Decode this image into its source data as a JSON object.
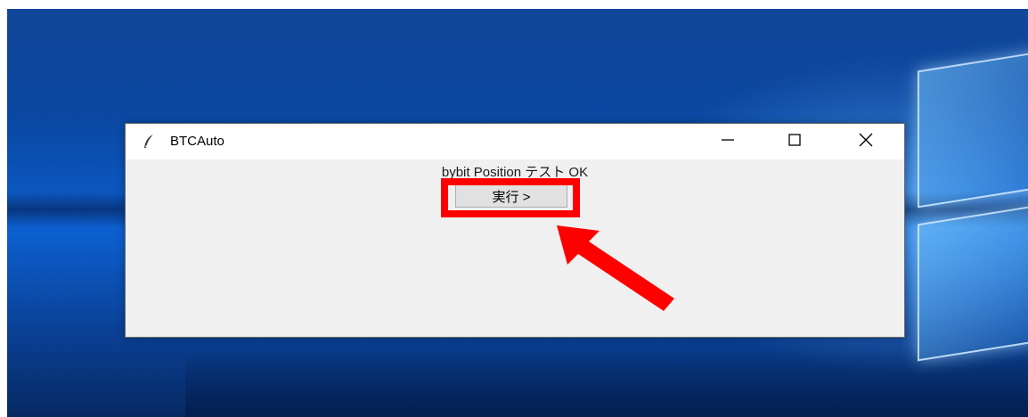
{
  "window": {
    "title": "BTCAuto",
    "icon": "feather-icon",
    "controls": {
      "minimize": "minimize-icon",
      "maximize": "maximize-icon",
      "close": "close-icon"
    }
  },
  "content": {
    "status_text": "bybit Position テスト OK",
    "run_button_label": "実行 >"
  },
  "annotation": {
    "color": "#ff0000",
    "highlight_target": "run-button",
    "arrow": "arrow-pointer-icon"
  },
  "desktop": {
    "wallpaper": "windows-10-default",
    "accent": "#0c5fcf"
  }
}
